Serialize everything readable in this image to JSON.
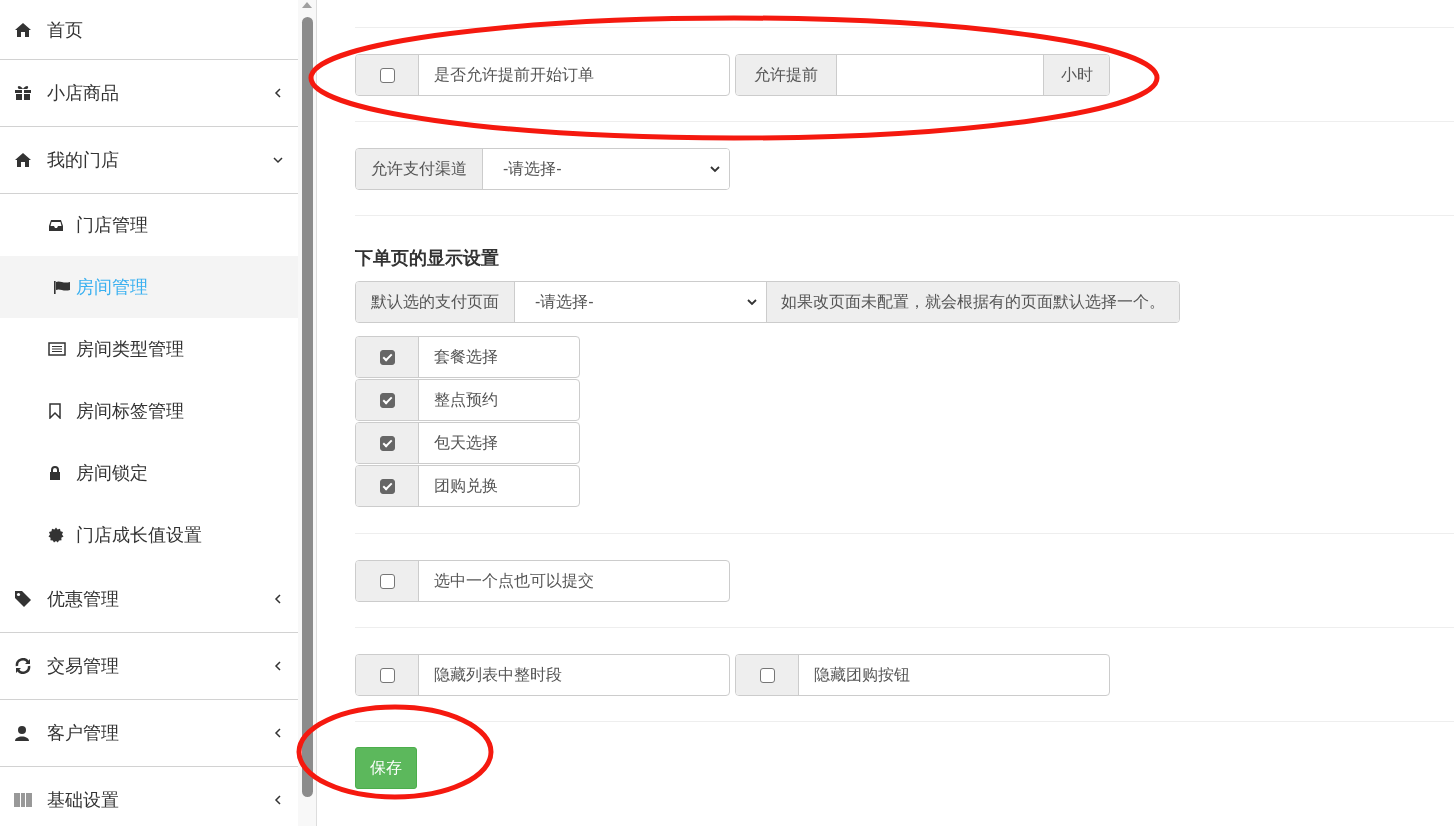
{
  "sidebar": {
    "items": [
      {
        "label": "首页",
        "kind": "link"
      },
      {
        "label": "小店商品",
        "kind": "menu",
        "expanded": false
      },
      {
        "label": "我的门店",
        "kind": "menu",
        "expanded": true,
        "children": [
          {
            "label": "门店管理",
            "selected": false
          },
          {
            "label": "房间管理",
            "selected": true
          },
          {
            "label": "房间类型管理",
            "selected": false
          },
          {
            "label": "房间标签管理",
            "selected": false
          },
          {
            "label": "房间锁定",
            "selected": false
          },
          {
            "label": "门店成长值设置",
            "selected": false
          }
        ]
      },
      {
        "label": "优惠管理",
        "kind": "menu",
        "expanded": false
      },
      {
        "label": "交易管理",
        "kind": "menu",
        "expanded": false
      },
      {
        "label": "客户管理",
        "kind": "menu",
        "expanded": false
      },
      {
        "label": "基础设置",
        "kind": "menu",
        "expanded": false
      }
    ]
  },
  "form": {
    "early_start": {
      "checkbox": {
        "label": "是否允许提前开始订单",
        "checked": false
      },
      "hours": {
        "prefix": "允许提前",
        "suffix": "小时"
      }
    },
    "payment_channel": {
      "label": "允许支付渠道",
      "value": "-请选择-"
    },
    "display_settings": {
      "heading": "下单页的显示设置",
      "payment_page": {
        "label": "默认选的支付页面",
        "value": "-请选择-",
        "help": "如果改页面未配置，就会根据有的页面默认选择一个。"
      },
      "options": [
        {
          "label": "套餐选择",
          "checked": true
        },
        {
          "label": "整点预约",
          "checked": true
        },
        {
          "label": "包天选择",
          "checked": true
        },
        {
          "label": "团购兑换",
          "checked": true
        }
      ]
    },
    "single_point": {
      "label": "选中一个点也可以提交",
      "checked": false
    },
    "hide_options": [
      {
        "label": "隐藏列表中整时段",
        "checked": false
      },
      {
        "label": "隐藏团购按钮",
        "checked": false
      }
    ],
    "save_button": "保存"
  }
}
